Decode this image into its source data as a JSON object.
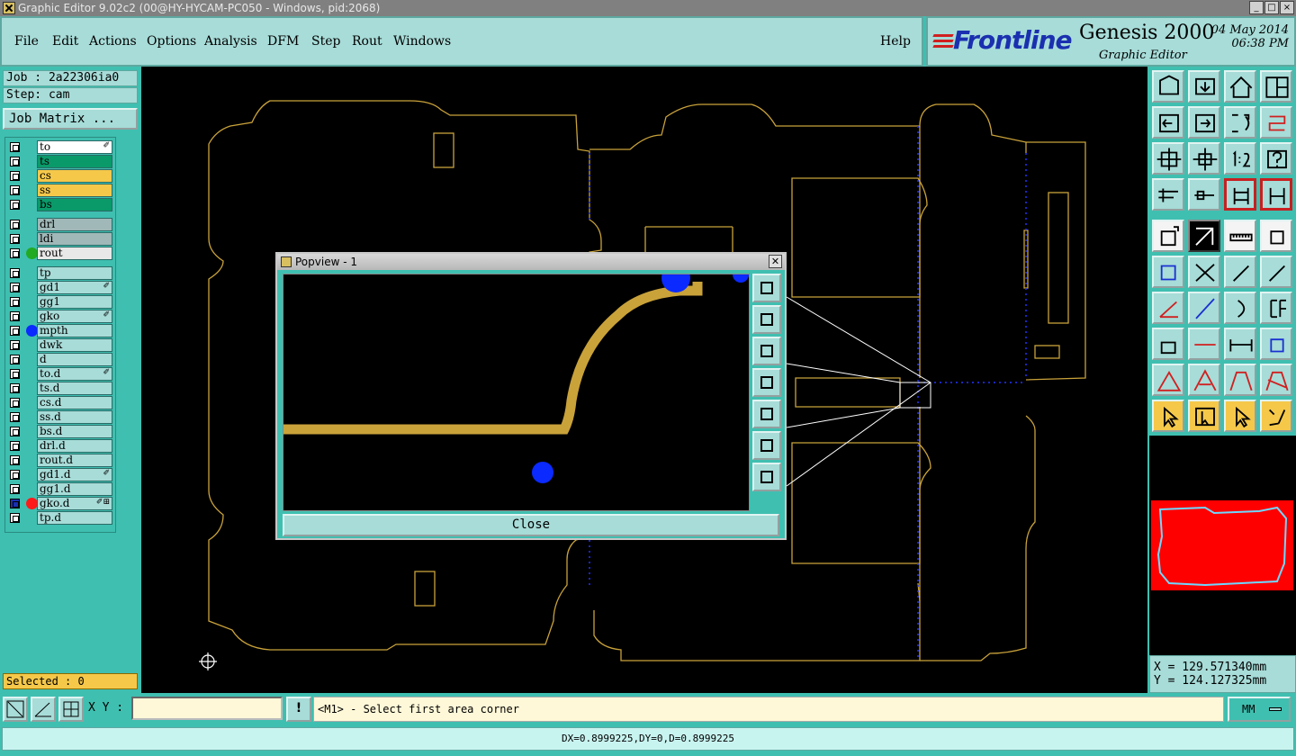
{
  "window": {
    "title": "Graphic Editor 9.02c2 (00@HY-HYCAM-PC050 - Windows, pid:2068)",
    "controls": [
      "_",
      "□",
      "×"
    ]
  },
  "menu": [
    {
      "label": "File"
    },
    {
      "label": "Edit"
    },
    {
      "label": "Actions"
    },
    {
      "label": "Options"
    },
    {
      "label": "Analysis"
    },
    {
      "label": "DFM"
    },
    {
      "label": "Step"
    },
    {
      "label": "Rout"
    },
    {
      "label": "Windows"
    },
    {
      "label": "Help"
    }
  ],
  "brand": {
    "logo": "Frontline",
    "product": "Genesis 2000",
    "subtitle": "Graphic Editor",
    "date": "04 May 2014",
    "time": "06:38 PM"
  },
  "job": {
    "job_line": "Job : 2a22306ia0",
    "step_line": "Step: cam",
    "matrix_button": "Job Matrix ..."
  },
  "layers": [
    {
      "name": "to",
      "color": "#ffffff",
      "mark": "✐",
      "dot": ""
    },
    {
      "name": "ts",
      "color": "#0a9a6a",
      "mark": "",
      "dot": ""
    },
    {
      "name": "cs",
      "color": "#f5c84a",
      "mark": "",
      "dot": ""
    },
    {
      "name": "ss",
      "color": "#f5c84a",
      "mark": "",
      "dot": ""
    },
    {
      "name": "bs",
      "color": "#0a9a6a",
      "mark": "",
      "dot": ""
    },
    {
      "name": "drl",
      "color": "#a0b8b8",
      "mark": "",
      "dot": ""
    },
    {
      "name": "ldi",
      "color": "#a0b8b8",
      "mark": "",
      "dot": ""
    },
    {
      "name": "rout",
      "color": "#e8e8e8",
      "mark": "",
      "dot": "#22aa22"
    },
    {
      "name": "tp",
      "color": "#a7dcd8",
      "mark": "",
      "dot": ""
    },
    {
      "name": "gd1",
      "color": "#a7dcd8",
      "mark": "✐",
      "dot": ""
    },
    {
      "name": "gg1",
      "color": "#a7dcd8",
      "mark": "",
      "dot": ""
    },
    {
      "name": "gko",
      "color": "#a7dcd8",
      "mark": "✐",
      "dot": ""
    },
    {
      "name": "mpth",
      "color": "#a7dcd8",
      "mark": "",
      "dot": "#0a2aff"
    },
    {
      "name": "dwk",
      "color": "#a7dcd8",
      "mark": "",
      "dot": ""
    },
    {
      "name": "d",
      "color": "#a7dcd8",
      "mark": "",
      "dot": ""
    },
    {
      "name": "to.d",
      "color": "#a7dcd8",
      "mark": "✐",
      "dot": ""
    },
    {
      "name": "ts.d",
      "color": "#a7dcd8",
      "mark": "",
      "dot": ""
    },
    {
      "name": "cs.d",
      "color": "#a7dcd8",
      "mark": "",
      "dot": ""
    },
    {
      "name": "ss.d",
      "color": "#a7dcd8",
      "mark": "",
      "dot": ""
    },
    {
      "name": "bs.d",
      "color": "#a7dcd8",
      "mark": "",
      "dot": ""
    },
    {
      "name": "drl.d",
      "color": "#a7dcd8",
      "mark": "",
      "dot": ""
    },
    {
      "name": "rout.d",
      "color": "#a7dcd8",
      "mark": "",
      "dot": ""
    },
    {
      "name": "gd1.d",
      "color": "#a7dcd8",
      "mark": "✐",
      "dot": ""
    },
    {
      "name": "gg1.d",
      "color": "#a7dcd8",
      "mark": "",
      "dot": ""
    },
    {
      "name": "gko.d",
      "color": "#a7dcd8",
      "mark": "✐⊞",
      "dot": "#ff1a1a",
      "selected": true
    },
    {
      "name": "tp.d",
      "color": "#a7dcd8",
      "mark": "",
      "dot": ""
    }
  ],
  "selected": "Selected : 0",
  "popview": {
    "title": "Popview - 1",
    "close_label": "Close"
  },
  "coords": {
    "x": "X = 129.571340mm",
    "y": "Y = 124.127325mm"
  },
  "bottom": {
    "xy_label": "X Y :",
    "xy_value": "",
    "bang": "!",
    "prompt": "<M1> - Select first area corner",
    "units": "MM"
  },
  "status": "DX=0.8999225,DY=0,D=0.8999225",
  "colors": {
    "panel": "#3fbfb0",
    "button": "#a7dcd8",
    "outline": "#c9a23a",
    "accent_blue": "#0a2aff"
  }
}
